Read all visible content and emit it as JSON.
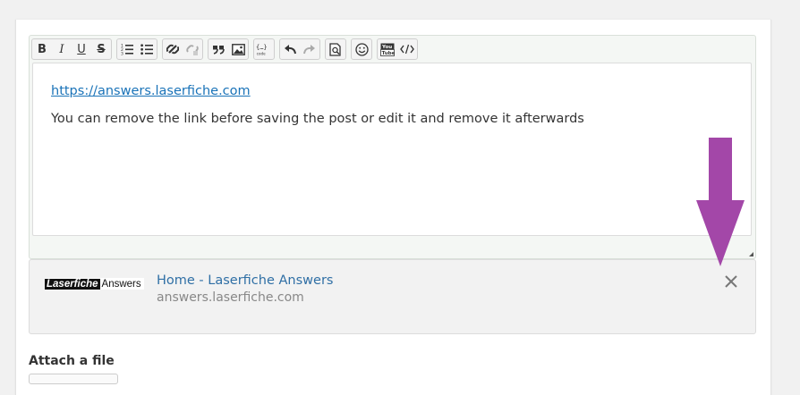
{
  "toolbar": {
    "groups": [
      [
        {
          "name": "bold-button",
          "icon": "bold-icon",
          "label": "B"
        },
        {
          "name": "italic-button",
          "icon": "italic-icon",
          "label": "I"
        },
        {
          "name": "underline-button",
          "icon": "underline-icon",
          "label": "U"
        },
        {
          "name": "strikethrough-button",
          "icon": "strikethrough-icon",
          "label": "S"
        }
      ],
      [
        {
          "name": "numbered-list-button",
          "icon": "numbered-list-icon"
        },
        {
          "name": "bulleted-list-button",
          "icon": "bulleted-list-icon"
        }
      ],
      [
        {
          "name": "link-button",
          "icon": "link-icon"
        },
        {
          "name": "unlink-button",
          "icon": "unlink-icon"
        }
      ],
      [
        {
          "name": "blockquote-button",
          "icon": "quote-icon"
        },
        {
          "name": "image-button",
          "icon": "image-icon"
        }
      ],
      [
        {
          "name": "code-snippet-button",
          "icon": "code-snippet-icon"
        }
      ],
      [
        {
          "name": "undo-button",
          "icon": "undo-icon"
        },
        {
          "name": "redo-button",
          "icon": "redo-icon"
        }
      ],
      [
        {
          "name": "preview-button",
          "icon": "preview-icon"
        }
      ],
      [
        {
          "name": "emoji-button",
          "icon": "smiley-icon"
        }
      ],
      [
        {
          "name": "youtube-button",
          "icon": "youtube-icon"
        },
        {
          "name": "source-button",
          "icon": "source-code-icon"
        }
      ]
    ]
  },
  "editor": {
    "link_text": "https://answers.laserfiche.com",
    "message": "You can remove the link before saving the post or edit it and remove it afterwards"
  },
  "preview": {
    "logo_brand": "Laserfiche",
    "logo_suffix": "Answers",
    "title": "Home - Laserfiche Answers",
    "domain": "answers.laserfiche.com"
  },
  "attach": {
    "label": "Attach a file"
  },
  "colors": {
    "link": "#1a73b8",
    "preview_title": "#2f6fa5",
    "annotation_arrow": "#a347a8"
  }
}
